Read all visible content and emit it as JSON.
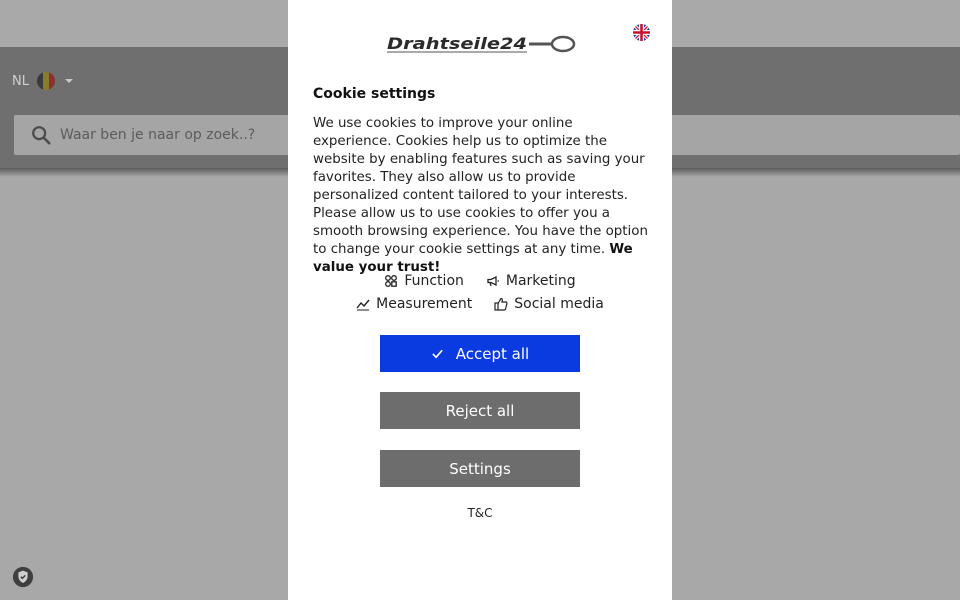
{
  "background": {
    "language_code": "NL",
    "search_placeholder": "Waar ben je naar op zoek..?"
  },
  "modal": {
    "logo_text": "Drahtseile24",
    "title": "Cookie settings",
    "description": "We use cookies to improve your online experience. Cookies help us to optimize the website by enabling features such as saving your favorites. They also allow us to provide personalized content tailored to your interests. Please allow us to use cookies to offer you a smooth browsing experience. You have the option to change your cookie settings at any time.",
    "description_bold": "We value your trust!",
    "categories": [
      {
        "label": "Function",
        "icon": "function-icon"
      },
      {
        "label": "Marketing",
        "icon": "megaphone-icon"
      },
      {
        "label": "Measurement",
        "icon": "chart-icon"
      },
      {
        "label": "Social media",
        "icon": "thumbs-up-icon"
      }
    ],
    "buttons": {
      "accept": "Accept all",
      "reject": "Reject all",
      "settings": "Settings"
    },
    "terms_link": "T&C"
  },
  "colors": {
    "accept": "#0a3be0",
    "secondary": "#6d6d6d"
  }
}
